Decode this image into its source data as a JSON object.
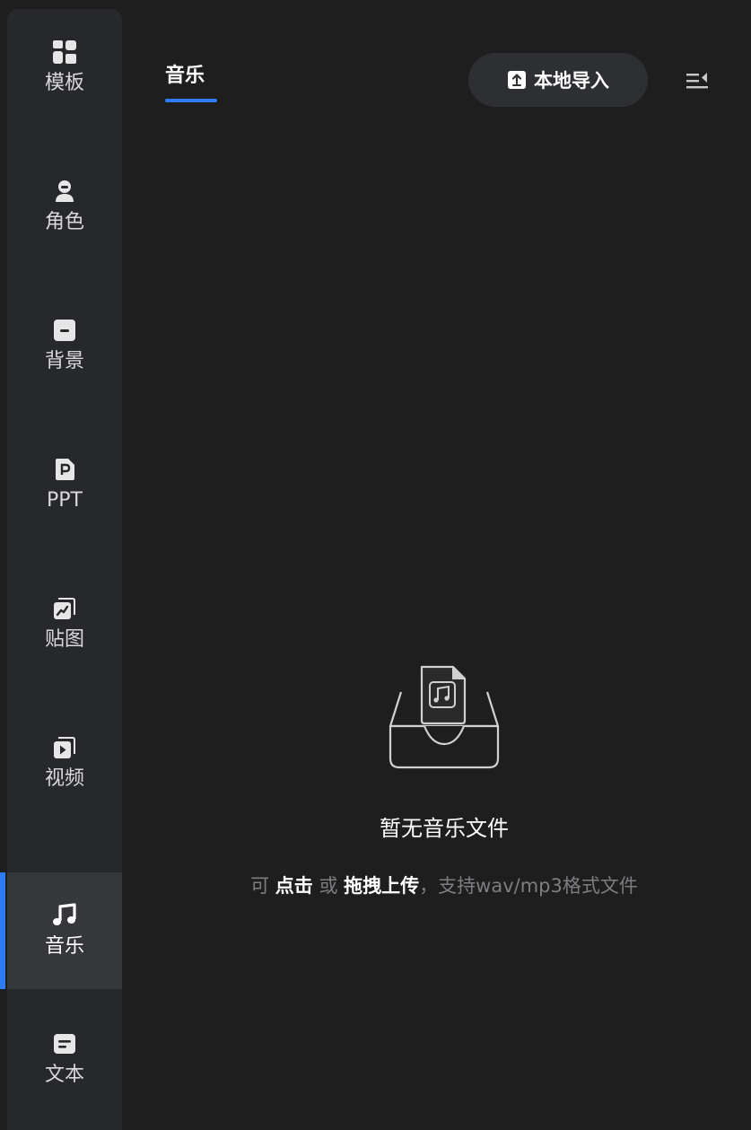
{
  "sidebar": {
    "items": [
      {
        "label": "模板",
        "icon": "template-icon"
      },
      {
        "label": "角色",
        "icon": "character-icon"
      },
      {
        "label": "背景",
        "icon": "background-icon"
      },
      {
        "label": "PPT",
        "icon": "ppt-icon"
      },
      {
        "label": "贴图",
        "icon": "sticker-icon"
      },
      {
        "label": "视频",
        "icon": "video-icon"
      },
      {
        "label": "音乐",
        "icon": "music-icon",
        "active": true
      },
      {
        "label": "文本",
        "icon": "text-icon"
      }
    ]
  },
  "header": {
    "tab_label": "音乐",
    "import_label": "本地导入"
  },
  "empty_state": {
    "title": "暂无音乐文件",
    "hint_prefix": "可",
    "hint_click": "点击",
    "hint_or": "或",
    "hint_drag": "拖拽上传",
    "hint_suffix": "，支持wav/mp3格式文件"
  },
  "colors": {
    "accent": "#2d7cf6",
    "sidebar_bg": "#26282c",
    "panel_bg": "#1e1e1e"
  }
}
